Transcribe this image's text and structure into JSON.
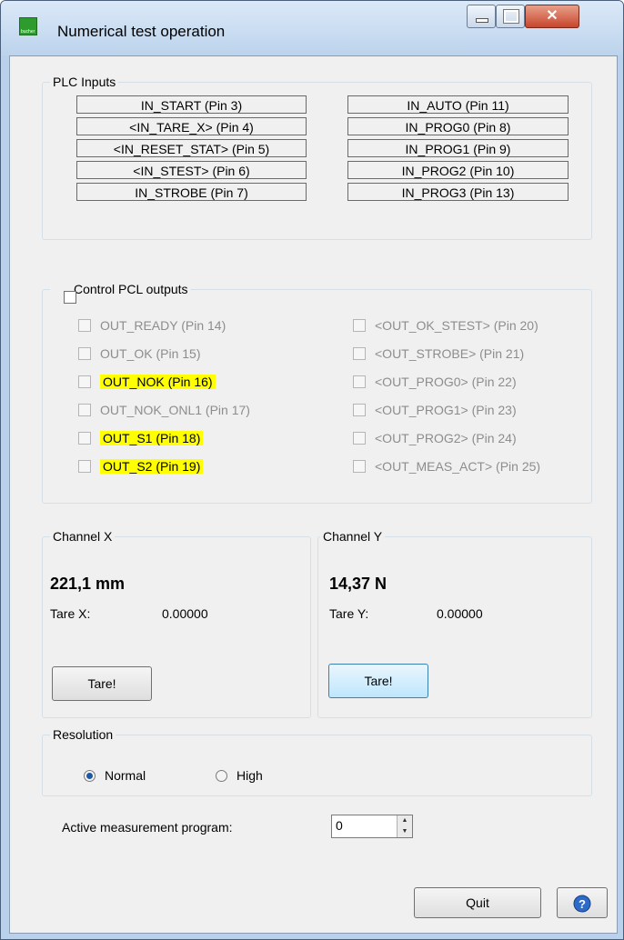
{
  "window": {
    "title": "Numerical test operation",
    "icon": "app-icon",
    "icon_text": "bucher"
  },
  "plc_inputs": {
    "legend": "PLC Inputs",
    "left": [
      "IN_START (Pin 3)",
      "<IN_TARE_X> (Pin 4)",
      "<IN_RESET_STAT> (Pin 5)",
      "<IN_STEST> (Pin 6)",
      "IN_STROBE (Pin 7)"
    ],
    "right": [
      "IN_AUTO (Pin 11)",
      "IN_PROG0 (Pin 8)",
      "IN_PROG1 (Pin 9)",
      "IN_PROG2 (Pin 10)",
      "IN_PROG3 (Pin 13)"
    ]
  },
  "plc_outputs": {
    "legend": "Control PCL outputs",
    "left": [
      "OUT_READY (Pin 14)",
      "OUT_OK (Pin 15)",
      "OUT_NOK (Pin 16)",
      "OUT_NOK_ONL1 (Pin 17)",
      "OUT_S1 (Pin 18)",
      "OUT_S2 (Pin 19)"
    ],
    "right": [
      "<OUT_OK_STEST> (Pin 20)",
      "<OUT_STROBE> (Pin 21)",
      "<OUT_PROG0> (Pin 22)",
      "<OUT_PROG1> (Pin 23)",
      "<OUT_PROG2> (Pin 24)",
      "<OUT_MEAS_ACT> (Pin 25)"
    ],
    "highlight_color": "#ffff00"
  },
  "channel_x": {
    "legend": "Channel X",
    "value": "221,1 mm",
    "tare_label": "Tare X:",
    "tare_value": "0.00000",
    "button": "Tare!"
  },
  "channel_y": {
    "legend": "Channel Y",
    "value": "14,37 N",
    "tare_label": "Tare Y:",
    "tare_value": "0.00000",
    "button": "Tare!"
  },
  "resolution": {
    "legend": "Resolution",
    "options": [
      "Normal",
      "High"
    ],
    "selected": "Normal"
  },
  "program": {
    "label": "Active measurement program:",
    "value": "0"
  },
  "footer": {
    "quit": "Quit",
    "help_icon": "help-icon"
  }
}
